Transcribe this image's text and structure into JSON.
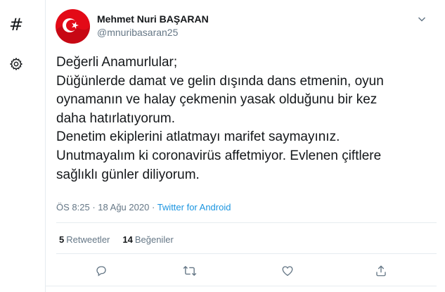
{
  "sidebar": {
    "explore_icon": "hashtag-icon",
    "settings_icon": "gear-icon"
  },
  "tweet": {
    "author_name": "Mehmet Nuri BAŞARAN",
    "handle": "@mnuribasaran25",
    "text_lines": [
      "Değerli Anamurlular;",
      "Düğünlerde damat ve gelin dışında dans etmenin, oyun",
      "oynamanın ve halay çekmenin yasak olduğunu bir kez",
      "daha hatırlatıyorum.",
      "Denetim ekiplerini atlatmayı marifet saymayınız.",
      "Unutmayalım ki coronavirüs affetmiyor. Evlenen çiftlere",
      "sağlıklı günler diliyorum."
    ],
    "time": "ÖS 8:25",
    "separator": "·",
    "date": "18 Ağu 2020",
    "source": "Twitter for Android",
    "retweet_count": "5",
    "retweet_label": "Retweetler",
    "like_count": "14",
    "like_label": "Beğeniler"
  },
  "colors": {
    "text": "#14171a",
    "muted": "#657786",
    "link": "#1b95e0",
    "divider": "#e6ecf0",
    "avatar_red": "#e30a17"
  },
  "actions": [
    "reply-icon",
    "retweet-icon",
    "like-icon",
    "share-icon"
  ]
}
